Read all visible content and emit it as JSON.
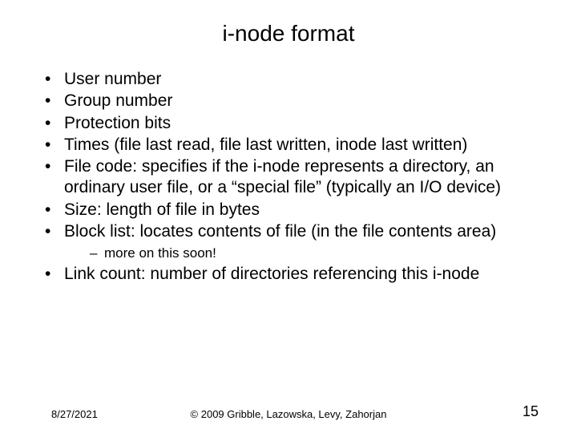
{
  "title": "i-node format",
  "bullets": [
    {
      "text": "User number"
    },
    {
      "text": "Group number"
    },
    {
      "text": "Protection bits"
    },
    {
      "text": "Times (file last read, file last written, inode last written)"
    },
    {
      "text": "File code:  specifies if the i-node represents a directory, an ordinary user file, or a “special file” (typically an I/O device)"
    },
    {
      "text": "Size:  length of file in bytes"
    },
    {
      "text": "Block list:  locates contents of file (in the file contents area)",
      "sub": [
        "more on this soon!"
      ]
    },
    {
      "text": "Link count:  number of directories referencing this i-node"
    }
  ],
  "footer": {
    "date": "8/27/2021",
    "copyright": "© 2009 Gribble, Lazowska, Levy, Zahorjan",
    "page": "15"
  }
}
